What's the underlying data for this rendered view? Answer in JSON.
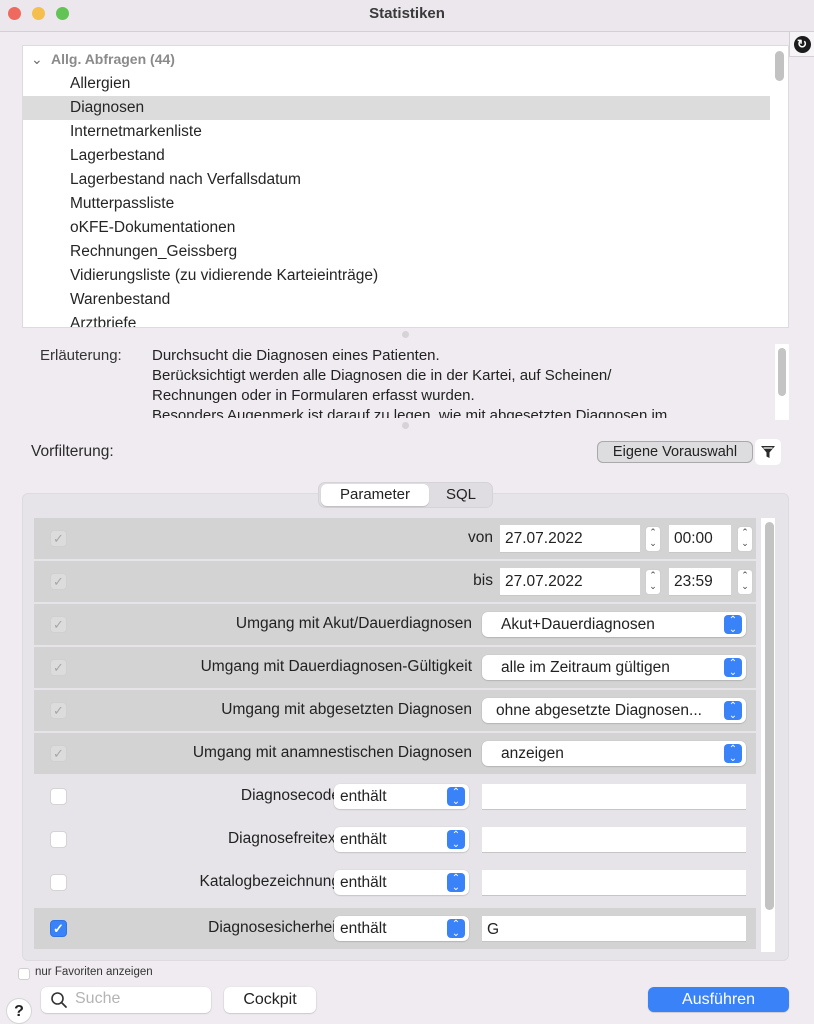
{
  "window": {
    "title": "Statistiken"
  },
  "query_list": {
    "group_label": "Allg. Abfragen (44)",
    "selected_index": 1,
    "items": [
      "Allergien",
      "Diagnosen",
      "Internetmarkenliste",
      "Lagerbestand",
      "Lagerbestand nach Verfallsdatum",
      "Mutterpassliste",
      "oKFE-Dokumentationen",
      "Rechnungen_Geissberg",
      "Vidierungsliste (zu vidierende Karteieinträge)",
      "Warenbestand",
      "Arztbriefe"
    ]
  },
  "explanation": {
    "label": "Erläuterung:",
    "lines": [
      "Durchsucht die Diagnosen eines Patienten.",
      "Berücksichtigt werden alle Diagnosen die in der Kartei, auf Scheinen/",
      "Rechnungen oder in Formularen erfasst wurden.",
      "Besonders Augenmerk ist darauf zu legen, wie mit abgesetzten Diagnosen im"
    ]
  },
  "prefilter": {
    "label": "Vorfilterung:",
    "own_selection_button": "Eigene Vorauswahl",
    "filter_icon": "filter-icon"
  },
  "tabs": {
    "parameter": "Parameter",
    "sql": "SQL",
    "active": "parameter"
  },
  "params": {
    "von": {
      "label": "von",
      "date": "27.07.2022",
      "time": "00:00",
      "checked": true,
      "enabled": false
    },
    "bis": {
      "label": "bis",
      "date": "27.07.2022",
      "time": "23:59",
      "checked": true,
      "enabled": false
    },
    "akut": {
      "label": "Umgang mit Akut/Dauerdiagnosen",
      "value": "Akut+Dauerdiagnosen",
      "checked": true,
      "enabled": false
    },
    "gueltigkeit": {
      "label": "Umgang mit Dauerdiagnosen-Gültigkeit",
      "value": "alle im Zeitraum gültigen",
      "checked": true,
      "enabled": false
    },
    "abgesetzt": {
      "label": "Umgang mit abgesetzten Diagnosen",
      "value": "ohne abgesetzte Diagnosen...",
      "checked": true,
      "enabled": false
    },
    "anamnestisch": {
      "label": "Umgang mit anamnestischen Diagnosen",
      "value": "anzeigen",
      "checked": true,
      "enabled": false
    },
    "code": {
      "label": "Diagnosecode",
      "operator": "enthält",
      "value": "",
      "checked": false
    },
    "freitext": {
      "label": "Diagnosefreitext",
      "operator": "enthält",
      "value": "",
      "checked": false
    },
    "katalog": {
      "label": "Katalogbezeichnung",
      "operator": "enthält",
      "value": "",
      "checked": false
    },
    "sicherheit": {
      "label": "Diagnosesicherheit",
      "operator": "enthält",
      "value": "G",
      "checked": true
    }
  },
  "footer": {
    "favorites_label": "nur Favoriten anzeigen",
    "favorites_checked": false,
    "search_placeholder": "Suche",
    "cockpit_button": "Cockpit",
    "run_button": "Ausführen",
    "help_label": "?"
  },
  "colors": {
    "accent": "#3a82f7",
    "selected_row": "#dcdcdc"
  }
}
